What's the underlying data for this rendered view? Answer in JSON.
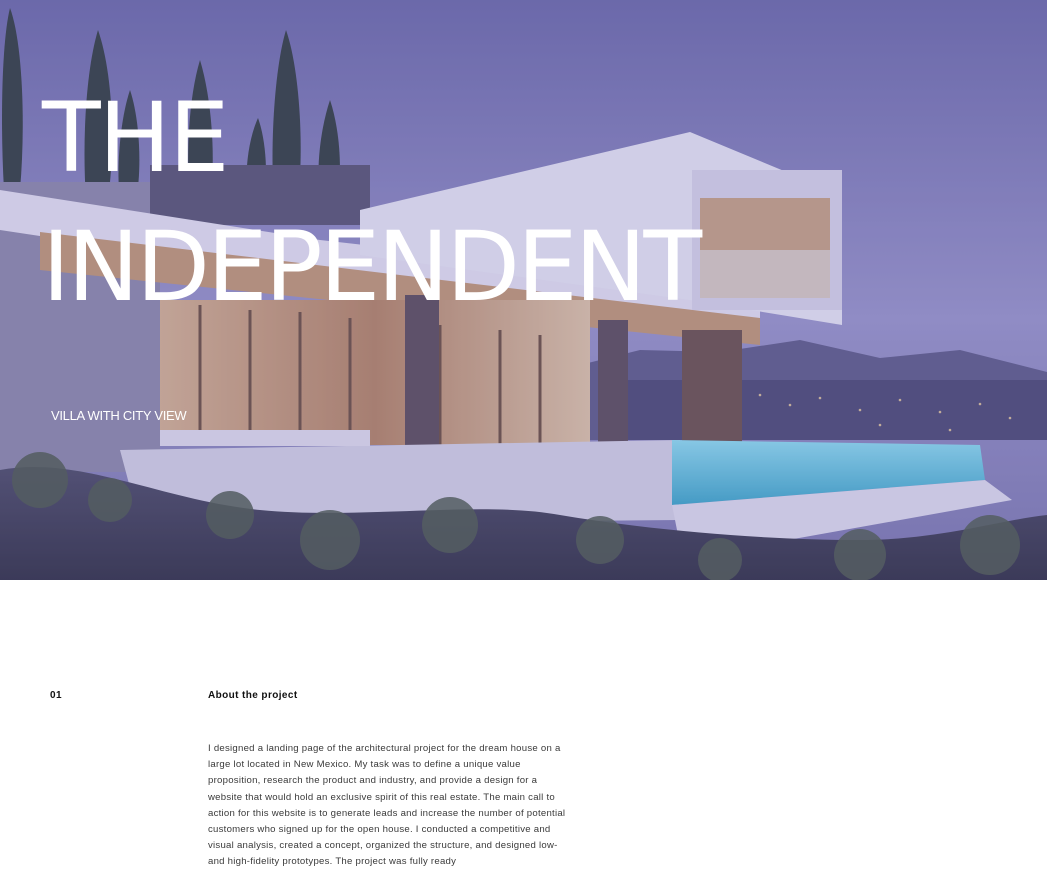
{
  "hero": {
    "title_line1": "THE",
    "title_line2": "INDEPENDENT",
    "subtitle": "VILLA WITH CITY VIEW",
    "overlay_color": "#7f7cb8"
  },
  "about": {
    "number": "01",
    "heading": "About the project",
    "body": "I designed a landing page of the architectural project for the dream house on a large lot located in New Mexico. My task was to define a unique value proposition, research the product and industry, and provide a design for a website that would hold an exclusive spirit of this real estate. The main call to action for this website is to generate leads and increase the number of potential customers who signed up for the open house. I conducted a competitive and visual analysis, created a concept, organized the structure, and designed low- and high-fidelity prototypes. The project was fully ready"
  }
}
